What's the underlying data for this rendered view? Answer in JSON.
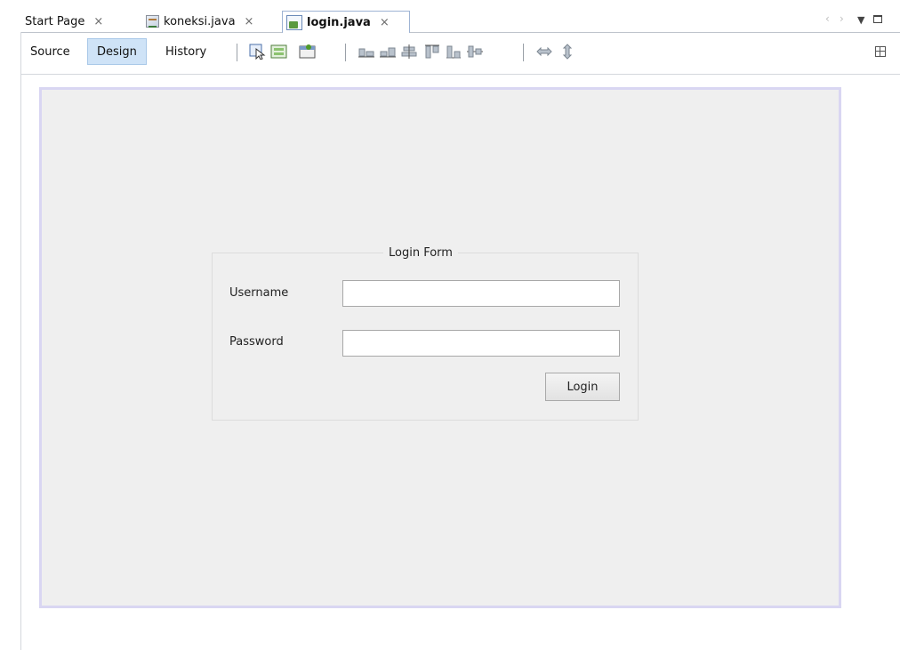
{
  "tabs": [
    {
      "label": "Start Page",
      "close": "×"
    },
    {
      "label": "koneksi.java",
      "close": "×"
    },
    {
      "label": "login.java",
      "close": "×",
      "active": true
    }
  ],
  "window_controls": {
    "prev": "‹",
    "next": "›",
    "menu": "▼"
  },
  "toolbar": {
    "source_label": "Source",
    "design_label": "Design",
    "history_label": "History",
    "active_view": "Design"
  },
  "form": {
    "panel_title": "Login Form",
    "username_label": "Username",
    "username_value": "",
    "password_label": "Password",
    "password_value": "",
    "login_button": "Login"
  },
  "colors": {
    "design_tab_active": "#cfe3f7",
    "frame_border": "#d9d6f2",
    "canvas_bg": "#efefef"
  }
}
